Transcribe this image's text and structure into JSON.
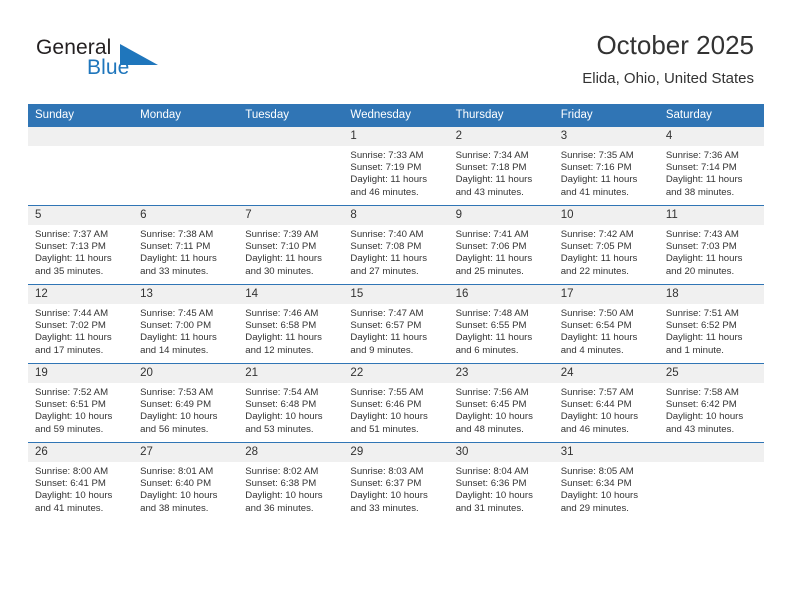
{
  "brand": {
    "word1": "General",
    "word2": "Blue",
    "accent_color": "#1f76bc"
  },
  "header": {
    "title": "October 2025",
    "location": "Elida, Ohio, United States"
  },
  "calendar": {
    "header_color": "#3075b5",
    "weekday_headers": [
      "Sunday",
      "Monday",
      "Tuesday",
      "Wednesday",
      "Thursday",
      "Friday",
      "Saturday"
    ],
    "labels": {
      "sunrise": "Sunrise:",
      "sunset": "Sunset:",
      "daylight": "Daylight:"
    },
    "weeks": [
      [
        {
          "day": "",
          "empty": true,
          "sunrise": "",
          "sunset": "",
          "daylight": ""
        },
        {
          "day": "",
          "empty": true,
          "sunrise": "",
          "sunset": "",
          "daylight": ""
        },
        {
          "day": "",
          "empty": true,
          "sunrise": "",
          "sunset": "",
          "daylight": ""
        },
        {
          "day": "1",
          "empty": false,
          "sunrise": "Sunrise: 7:33 AM",
          "sunset": "Sunset: 7:19 PM",
          "daylight": "Daylight: 11 hours and 46 minutes."
        },
        {
          "day": "2",
          "empty": false,
          "sunrise": "Sunrise: 7:34 AM",
          "sunset": "Sunset: 7:18 PM",
          "daylight": "Daylight: 11 hours and 43 minutes."
        },
        {
          "day": "3",
          "empty": false,
          "sunrise": "Sunrise: 7:35 AM",
          "sunset": "Sunset: 7:16 PM",
          "daylight": "Daylight: 11 hours and 41 minutes."
        },
        {
          "day": "4",
          "empty": false,
          "sunrise": "Sunrise: 7:36 AM",
          "sunset": "Sunset: 7:14 PM",
          "daylight": "Daylight: 11 hours and 38 minutes."
        }
      ],
      [
        {
          "day": "5",
          "empty": false,
          "sunrise": "Sunrise: 7:37 AM",
          "sunset": "Sunset: 7:13 PM",
          "daylight": "Daylight: 11 hours and 35 minutes."
        },
        {
          "day": "6",
          "empty": false,
          "sunrise": "Sunrise: 7:38 AM",
          "sunset": "Sunset: 7:11 PM",
          "daylight": "Daylight: 11 hours and 33 minutes."
        },
        {
          "day": "7",
          "empty": false,
          "sunrise": "Sunrise: 7:39 AM",
          "sunset": "Sunset: 7:10 PM",
          "daylight": "Daylight: 11 hours and 30 minutes."
        },
        {
          "day": "8",
          "empty": false,
          "sunrise": "Sunrise: 7:40 AM",
          "sunset": "Sunset: 7:08 PM",
          "daylight": "Daylight: 11 hours and 27 minutes."
        },
        {
          "day": "9",
          "empty": false,
          "sunrise": "Sunrise: 7:41 AM",
          "sunset": "Sunset: 7:06 PM",
          "daylight": "Daylight: 11 hours and 25 minutes."
        },
        {
          "day": "10",
          "empty": false,
          "sunrise": "Sunrise: 7:42 AM",
          "sunset": "Sunset: 7:05 PM",
          "daylight": "Daylight: 11 hours and 22 minutes."
        },
        {
          "day": "11",
          "empty": false,
          "sunrise": "Sunrise: 7:43 AM",
          "sunset": "Sunset: 7:03 PM",
          "daylight": "Daylight: 11 hours and 20 minutes."
        }
      ],
      [
        {
          "day": "12",
          "empty": false,
          "sunrise": "Sunrise: 7:44 AM",
          "sunset": "Sunset: 7:02 PM",
          "daylight": "Daylight: 11 hours and 17 minutes."
        },
        {
          "day": "13",
          "empty": false,
          "sunrise": "Sunrise: 7:45 AM",
          "sunset": "Sunset: 7:00 PM",
          "daylight": "Daylight: 11 hours and 14 minutes."
        },
        {
          "day": "14",
          "empty": false,
          "sunrise": "Sunrise: 7:46 AM",
          "sunset": "Sunset: 6:58 PM",
          "daylight": "Daylight: 11 hours and 12 minutes."
        },
        {
          "day": "15",
          "empty": false,
          "sunrise": "Sunrise: 7:47 AM",
          "sunset": "Sunset: 6:57 PM",
          "daylight": "Daylight: 11 hours and 9 minutes."
        },
        {
          "day": "16",
          "empty": false,
          "sunrise": "Sunrise: 7:48 AM",
          "sunset": "Sunset: 6:55 PM",
          "daylight": "Daylight: 11 hours and 6 minutes."
        },
        {
          "day": "17",
          "empty": false,
          "sunrise": "Sunrise: 7:50 AM",
          "sunset": "Sunset: 6:54 PM",
          "daylight": "Daylight: 11 hours and 4 minutes."
        },
        {
          "day": "18",
          "empty": false,
          "sunrise": "Sunrise: 7:51 AM",
          "sunset": "Sunset: 6:52 PM",
          "daylight": "Daylight: 11 hours and 1 minute."
        }
      ],
      [
        {
          "day": "19",
          "empty": false,
          "sunrise": "Sunrise: 7:52 AM",
          "sunset": "Sunset: 6:51 PM",
          "daylight": "Daylight: 10 hours and 59 minutes."
        },
        {
          "day": "20",
          "empty": false,
          "sunrise": "Sunrise: 7:53 AM",
          "sunset": "Sunset: 6:49 PM",
          "daylight": "Daylight: 10 hours and 56 minutes."
        },
        {
          "day": "21",
          "empty": false,
          "sunrise": "Sunrise: 7:54 AM",
          "sunset": "Sunset: 6:48 PM",
          "daylight": "Daylight: 10 hours and 53 minutes."
        },
        {
          "day": "22",
          "empty": false,
          "sunrise": "Sunrise: 7:55 AM",
          "sunset": "Sunset: 6:46 PM",
          "daylight": "Daylight: 10 hours and 51 minutes."
        },
        {
          "day": "23",
          "empty": false,
          "sunrise": "Sunrise: 7:56 AM",
          "sunset": "Sunset: 6:45 PM",
          "daylight": "Daylight: 10 hours and 48 minutes."
        },
        {
          "day": "24",
          "empty": false,
          "sunrise": "Sunrise: 7:57 AM",
          "sunset": "Sunset: 6:44 PM",
          "daylight": "Daylight: 10 hours and 46 minutes."
        },
        {
          "day": "25",
          "empty": false,
          "sunrise": "Sunrise: 7:58 AM",
          "sunset": "Sunset: 6:42 PM",
          "daylight": "Daylight: 10 hours and 43 minutes."
        }
      ],
      [
        {
          "day": "26",
          "empty": false,
          "sunrise": "Sunrise: 8:00 AM",
          "sunset": "Sunset: 6:41 PM",
          "daylight": "Daylight: 10 hours and 41 minutes."
        },
        {
          "day": "27",
          "empty": false,
          "sunrise": "Sunrise: 8:01 AM",
          "sunset": "Sunset: 6:40 PM",
          "daylight": "Daylight: 10 hours and 38 minutes."
        },
        {
          "day": "28",
          "empty": false,
          "sunrise": "Sunrise: 8:02 AM",
          "sunset": "Sunset: 6:38 PM",
          "daylight": "Daylight: 10 hours and 36 minutes."
        },
        {
          "day": "29",
          "empty": false,
          "sunrise": "Sunrise: 8:03 AM",
          "sunset": "Sunset: 6:37 PM",
          "daylight": "Daylight: 10 hours and 33 minutes."
        },
        {
          "day": "30",
          "empty": false,
          "sunrise": "Sunrise: 8:04 AM",
          "sunset": "Sunset: 6:36 PM",
          "daylight": "Daylight: 10 hours and 31 minutes."
        },
        {
          "day": "31",
          "empty": false,
          "sunrise": "Sunrise: 8:05 AM",
          "sunset": "Sunset: 6:34 PM",
          "daylight": "Daylight: 10 hours and 29 minutes."
        },
        {
          "day": "",
          "empty": true,
          "sunrise": "",
          "sunset": "",
          "daylight": ""
        }
      ]
    ]
  }
}
